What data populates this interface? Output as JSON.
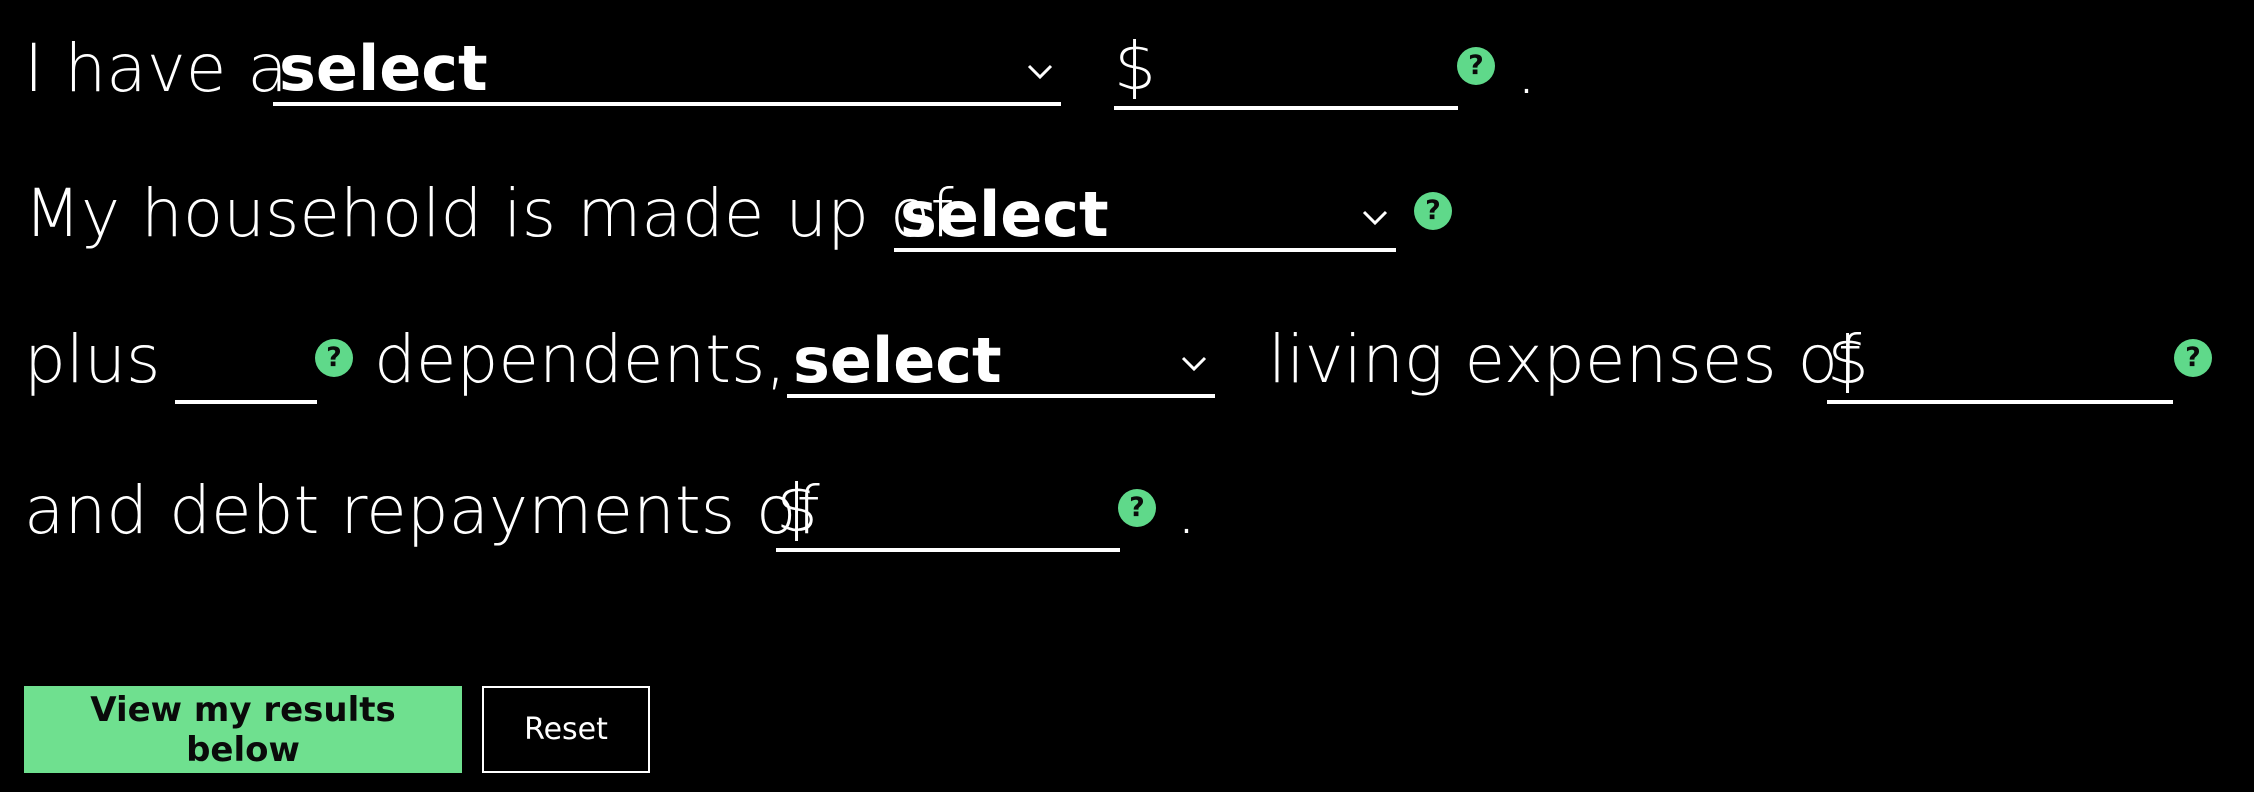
{
  "line1": {
    "prefix": "I have a",
    "select_value": "select",
    "currency": "$",
    "amount": "",
    "help": "?",
    "suffix": "."
  },
  "line2": {
    "prefix": "My household is made up of",
    "select_value": "select",
    "help": "?"
  },
  "line3": {
    "prefix": "plus",
    "dependents": "",
    "help_dependents": "?",
    "dependents_label": "dependents,",
    "select_value": "select",
    "living_label": "living expenses of",
    "currency": "$",
    "amount": "",
    "help_living": "?"
  },
  "line4": {
    "prefix": "and debt repayments of",
    "currency": "$",
    "amount": "",
    "help": "?",
    "suffix": "."
  },
  "buttons": {
    "primary_label": "View my results below",
    "reset_label": "Reset"
  },
  "colors": {
    "accent": "#6fe08f",
    "background": "#000000",
    "text": "#ffffff"
  },
  "icons": {
    "help": "help-icon",
    "chevron": "chevron-down-icon"
  }
}
